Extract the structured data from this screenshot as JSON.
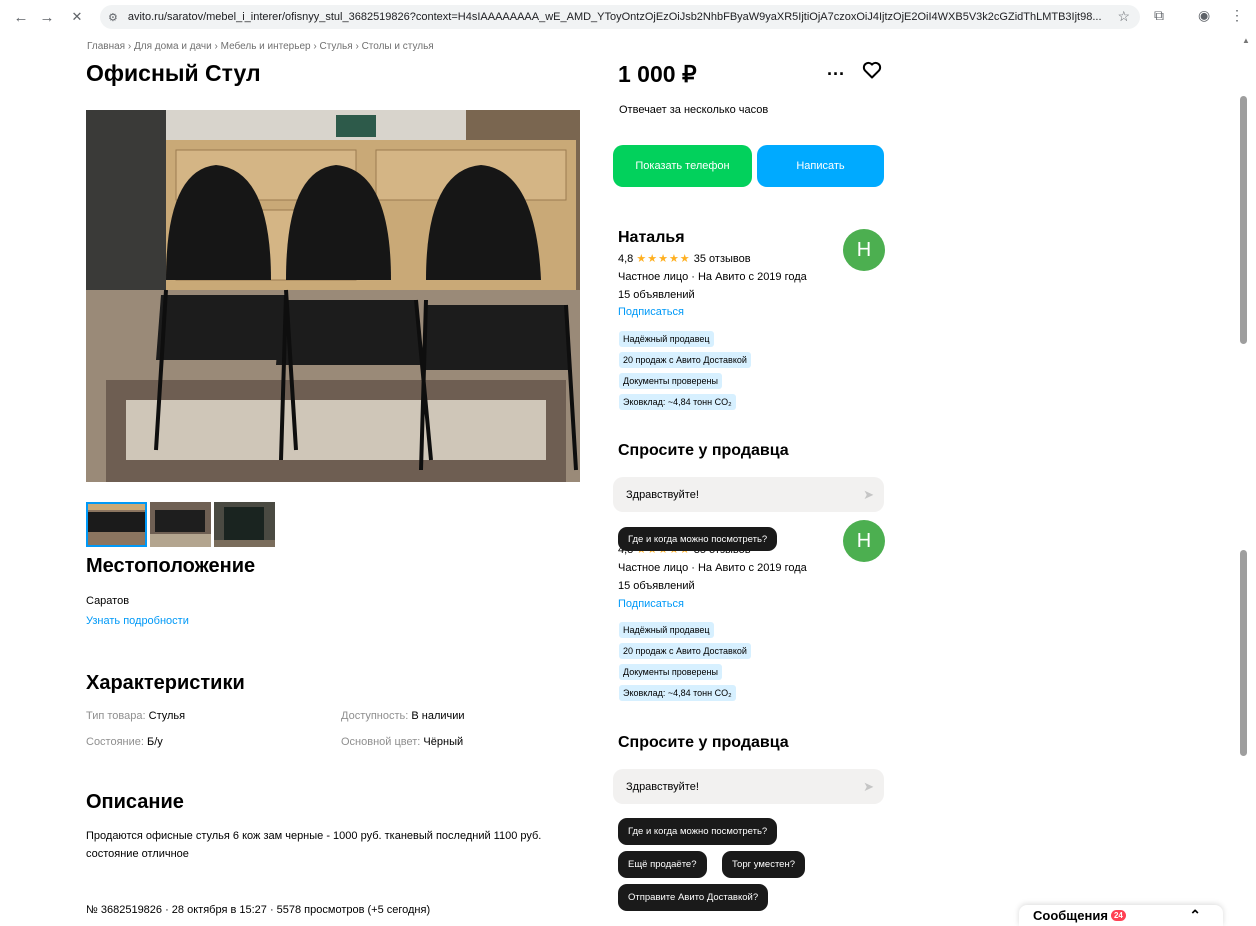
{
  "browser": {
    "back": "←",
    "forward": "→",
    "close": "✕",
    "url": "avito.ru/saratov/mebel_i_interer/ofisnyy_stul_3682519826?context=H4sIAAAAAAAA_wE_AMD_YToyOntzOjEzOiJsb2NhbFByaW9yaXR5IjtiOjA7czoxOiJ4IjtzOjE2OiI4WXB5V3k2cGZidThLMTB3Ijt98..."
  },
  "breadcrumb": [
    "Главная",
    "Для дома и дачи",
    "Мебель и интерьер",
    "Стулья",
    "Столы и стулья"
  ],
  "breadcrumb_sep": "›",
  "title": "Офисный Стул",
  "location": {
    "heading": "Местоположение",
    "city": "Саратов",
    "details_link": "Узнать подробности"
  },
  "specs": {
    "heading": "Характеристики",
    "items": [
      {
        "label": "Тип товара:",
        "value": "Стулья"
      },
      {
        "label": "Доступность:",
        "value": "В наличии"
      },
      {
        "label": "Состояние:",
        "value": "Б/у"
      },
      {
        "label": "Основной цвет:",
        "value": "Чёрный"
      }
    ]
  },
  "description": {
    "heading": "Описание",
    "text": "Продаются офисные стулья 6 кож зам черные - 1000 руб. тканевый последний 1100 руб. состояние отличное"
  },
  "listing_meta": "№ 3682519826 · 28 октября в 15:27 · 5578 просмотров (+5 сегодня)",
  "price": "1 000 ₽",
  "responds": "Отвечает за несколько часов",
  "buttons": {
    "phone": "Показать телефон",
    "write": "Написать"
  },
  "seller": {
    "name": "Наталья",
    "avatar_letter": "Н",
    "rating": "4,8",
    "stars": "★★★★★",
    "reviews": "35 отзывов",
    "type": "Частное лицо · На Авито с 2019 года",
    "listings": "15 объявлений",
    "subscribe": "Подписаться",
    "badges": [
      "Надёжный продавец",
      "20 продаж с Авито Доставкой",
      "Документы проверены",
      "Эковклад: ~4,84 тонн CO₂"
    ]
  },
  "ask": {
    "heading": "Спросите у продавца",
    "input_value": "Здравствуйте!",
    "chips": [
      "Где и когда можно посмотреть?",
      "Ещё продаёте?",
      "Торг уместен?",
      "Отправите Авито Доставкой?"
    ]
  },
  "messages": {
    "label": "Сообщения",
    "count": "24"
  },
  "colors": {
    "phone_button": "#02d15c",
    "write_button": "#00aaff",
    "link": "#0099f7",
    "star": "#ffb021",
    "badge_bg": "#d7f0ff",
    "avatar": "#4caf50"
  }
}
